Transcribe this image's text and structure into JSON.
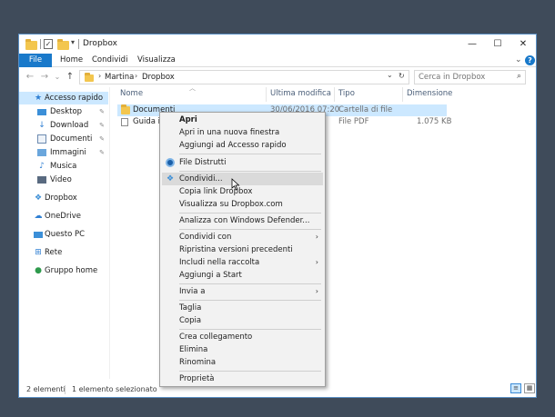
{
  "window": {
    "title": "Dropbox",
    "minimize_glyph": "—",
    "maximize_glyph": "☐",
    "close_glyph": "✕"
  },
  "ribbon": {
    "tabs": [
      "File",
      "Home",
      "Condividi",
      "Visualizza"
    ],
    "expand_glyph": "⌄",
    "help_glyph": "?"
  },
  "nav": {
    "back_glyph": "←",
    "forward_glyph": "→",
    "recent_glyph": "⌄",
    "up_glyph": "↑",
    "breadcrumb": [
      "Martina",
      "Dropbox"
    ],
    "crumb_sep": "›",
    "dropdown_glyph": "⌄",
    "refresh_glyph": "↻",
    "search_placeholder": "Cerca in Dropbox",
    "search_glyph": "⌕"
  },
  "sidebar": {
    "items": [
      {
        "label": "Accesso rapido",
        "icon": "star-icon",
        "pinned": false,
        "selected": true
      },
      {
        "label": "Desktop",
        "icon": "desktop-icon",
        "pinned": true,
        "selected": false
      },
      {
        "label": "Download",
        "icon": "download-icon",
        "pinned": true,
        "selected": false
      },
      {
        "label": "Documenti",
        "icon": "documents-icon",
        "pinned": true,
        "selected": false
      },
      {
        "label": "Immagini",
        "icon": "pictures-icon",
        "pinned": true,
        "selected": false
      },
      {
        "label": "Musica",
        "icon": "music-icon",
        "pinned": false,
        "selected": false
      },
      {
        "label": "Video",
        "icon": "video-icon",
        "pinned": false,
        "selected": false
      },
      {
        "label": "Dropbox",
        "icon": "dropbox-icon",
        "pinned": false,
        "selected": false
      },
      {
        "label": "OneDrive",
        "icon": "onedrive-icon",
        "pinned": false,
        "selected": false
      },
      {
        "label": "Questo PC",
        "icon": "computer-icon",
        "pinned": false,
        "selected": false
      },
      {
        "label": "Rete",
        "icon": "network-icon",
        "pinned": false,
        "selected": false
      },
      {
        "label": "Gruppo home",
        "icon": "homegroup-icon",
        "pinned": false,
        "selected": false
      }
    ]
  },
  "columns": [
    "Nome",
    "Ultima modifica",
    "Tipo",
    "Dimensione"
  ],
  "files": [
    {
      "name": "Documenti",
      "modified": "30/06/2016 07:20",
      "type": "Cartella di file",
      "size": "",
      "icon": "folder-icon",
      "selected": true
    },
    {
      "name": "Guida int",
      "modified": "",
      "type": "File PDF",
      "size": "1.075 KB",
      "icon": "pdf-icon",
      "selected": false
    }
  ],
  "status": {
    "count": "2 elementi",
    "selected": "1 elemento selezionato"
  },
  "context_menu": {
    "submenu_glyph": "›",
    "groups": [
      [
        {
          "label": "Apri",
          "bold": true
        },
        {
          "label": "Apri in una nuova finestra"
        },
        {
          "label": "Aggiungi ad Accesso rapido"
        }
      ],
      [
        {
          "label": "File Distrutti",
          "icon": "file-shredder-icon"
        }
      ],
      [
        {
          "label": "Condividi...",
          "icon": "dropbox-share-icon",
          "hover": true
        },
        {
          "label": "Copia link Dropbox"
        },
        {
          "label": "Visualizza su Dropbox.com"
        }
      ],
      [
        {
          "label": "Analizza con Windows Defender..."
        }
      ],
      [
        {
          "label": "Condividi con",
          "submenu": true
        },
        {
          "label": "Ripristina versioni precedenti"
        },
        {
          "label": "Includi nella raccolta",
          "submenu": true
        },
        {
          "label": "Aggiungi a Start"
        }
      ],
      [
        {
          "label": "Invia a",
          "submenu": true
        }
      ],
      [
        {
          "label": "Taglia"
        },
        {
          "label": "Copia"
        }
      ],
      [
        {
          "label": "Crea collegamento"
        },
        {
          "label": "Elimina"
        },
        {
          "label": "Rinomina"
        }
      ],
      [
        {
          "label": "Proprietà"
        }
      ]
    ]
  },
  "colors": {
    "accent": "#1979ca",
    "selection": "#cce8ff",
    "folder": "#f3c64e",
    "shredder": "#1a5fa8",
    "dropbox": "#3d8fd6"
  }
}
